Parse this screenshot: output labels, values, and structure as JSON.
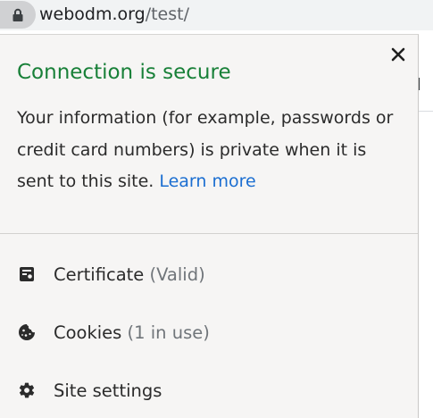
{
  "address_bar": {
    "host": "webodm.org",
    "path": "/test/",
    "lock_icon": "lock-icon"
  },
  "background_page": {
    "partial_text": "ed"
  },
  "popup": {
    "close_label": "✕",
    "title": "Connection is secure",
    "body": "Your information (for example, passwords or credit card numbers) is private when it is sent to this site. ",
    "learn_more": "Learn more",
    "items": [
      {
        "icon": "certificate-icon",
        "label": "Certificate",
        "sub": " (Valid)"
      },
      {
        "icon": "cookie-icon",
        "label": "Cookies",
        "sub": " (1 in use)"
      },
      {
        "icon": "gear-icon",
        "label": "Site settings",
        "sub": ""
      }
    ],
    "colors": {
      "title": "#188038",
      "link": "#1b6ed1",
      "popup_bg": "#f6f5f4"
    }
  }
}
